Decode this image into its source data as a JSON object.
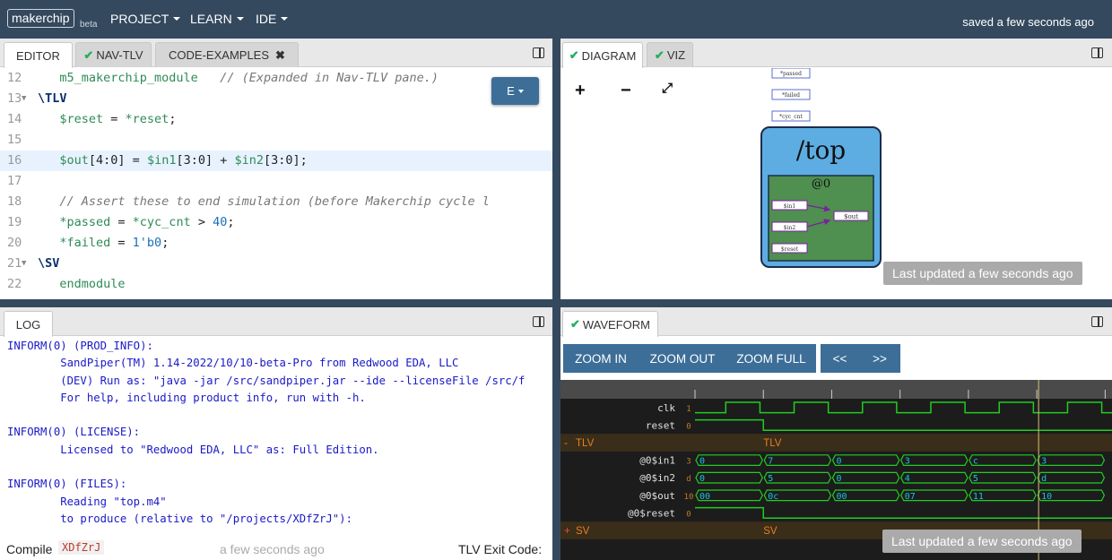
{
  "navbar": {
    "brand": "makerchip",
    "beta": "beta",
    "menus": [
      {
        "label": "PROJECT"
      },
      {
        "label": "LEARN"
      },
      {
        "label": "IDE"
      }
    ],
    "status": "saved a few seconds ago"
  },
  "editor_tabs": [
    {
      "label": "EDITOR",
      "active": true,
      "check": false,
      "close": false
    },
    {
      "label": "NAV-TLV",
      "active": false,
      "check": true,
      "close": false
    },
    {
      "label": "CODE-EXAMPLES",
      "active": false,
      "check": false,
      "close": true
    }
  ],
  "editor": {
    "e_button": "E",
    "lines": [
      {
        "num": "12",
        "fold": false,
        "parts": [
          {
            "t": "   m5_makerchip_module   ",
            "c": "green"
          },
          {
            "t": "// (Expanded in Nav-TLV pane.)",
            "c": "comment"
          }
        ]
      },
      {
        "num": "13",
        "fold": true,
        "parts": [
          {
            "t": "\\TLV",
            "c": "kw"
          }
        ]
      },
      {
        "num": "14",
        "fold": false,
        "parts": [
          {
            "t": "   $reset",
            "c": "green"
          },
          {
            "t": " = ",
            "c": "plain"
          },
          {
            "t": "*reset",
            "c": "green"
          },
          {
            "t": ";",
            "c": "plain"
          }
        ]
      },
      {
        "num": "15",
        "fold": false,
        "parts": []
      },
      {
        "num": "16",
        "fold": false,
        "highlight": true,
        "parts": [
          {
            "t": "   $out",
            "c": "green"
          },
          {
            "t": "[4:0]",
            "c": "plain"
          },
          {
            "t": " = ",
            "c": "plain"
          },
          {
            "t": "$in1",
            "c": "green"
          },
          {
            "t": "[3:0]",
            "c": "plain"
          },
          {
            "t": " + ",
            "c": "plain"
          },
          {
            "t": "$in2",
            "c": "green"
          },
          {
            "t": "[3:0]",
            "c": "plain"
          },
          {
            "t": ";",
            "c": "plain"
          }
        ]
      },
      {
        "num": "17",
        "fold": false,
        "parts": []
      },
      {
        "num": "18",
        "fold": false,
        "parts": [
          {
            "t": "   // Assert these to end simulation (before Makerchip cycle l",
            "c": "comment"
          }
        ]
      },
      {
        "num": "19",
        "fold": false,
        "parts": [
          {
            "t": "   *passed",
            "c": "green"
          },
          {
            "t": " = ",
            "c": "plain"
          },
          {
            "t": "*cyc_cnt",
            "c": "green"
          },
          {
            "t": " > ",
            "c": "plain"
          },
          {
            "t": "40",
            "c": "num"
          },
          {
            "t": ";",
            "c": "plain"
          }
        ]
      },
      {
        "num": "20",
        "fold": false,
        "parts": [
          {
            "t": "   *failed",
            "c": "green"
          },
          {
            "t": " = ",
            "c": "plain"
          },
          {
            "t": "1'b0",
            "c": "num"
          },
          {
            "t": ";",
            "c": "plain"
          }
        ]
      },
      {
        "num": "21",
        "fold": true,
        "parts": [
          {
            "t": "\\SV",
            "c": "kw"
          }
        ]
      },
      {
        "num": "22",
        "fold": false,
        "parts": [
          {
            "t": "   endmodule",
            "c": "green"
          }
        ]
      }
    ]
  },
  "diagram_tabs": [
    {
      "label": "DIAGRAM",
      "active": true
    },
    {
      "label": "VIZ",
      "active": false
    }
  ],
  "diagram": {
    "sigs": [
      "*passed",
      "*failed",
      "*cyc_cnt"
    ],
    "top_label": "/top",
    "stage_label": "@0",
    "inputs": [
      "$in1",
      "$in2",
      "$reset"
    ],
    "output": "$out",
    "status": "Last updated a few seconds ago"
  },
  "log": {
    "tab": "LOG",
    "lines": [
      "INFORM(0) (PROD_INFO):",
      "        SandPiper(TM) 1.14-2022/10/10-beta-Pro from Redwood EDA, LLC",
      "        (DEV) Run as: \"java -jar /src/sandpiper.jar --ide --licenseFile /src/f",
      "        For help, including product info, run with -h.",
      "",
      "INFORM(0) (LICENSE):",
      "        Licensed to \"Redwood EDA, LLC\" as: Full Edition.",
      "",
      "INFORM(0) (FILES):",
      "        Reading \"top.m4\"",
      "        to produce (relative to \"/projects/XDfZrJ\"):"
    ],
    "compile_label": "Compile",
    "compile_id": "XDfZrJ",
    "compile_time": "a few seconds ago",
    "exit_code_label": "TLV Exit Code:"
  },
  "waveform": {
    "tab": "WAVEFORM",
    "buttons": [
      "ZOOM IN",
      "ZOOM OUT",
      "ZOOM FULL"
    ],
    "nav_buttons": [
      "<<",
      ">>"
    ],
    "tlv_group": "TLV",
    "sv_group": "SV",
    "status": "Last updated a few seconds ago",
    "cycles_visible": 6.1,
    "cursor_at_cycle": 5,
    "signals": [
      {
        "name": "clk",
        "val": "1",
        "type": "clock"
      },
      {
        "name": "reset",
        "val": "0",
        "type": "bit",
        "values": [
          1,
          0,
          0,
          0,
          0,
          0,
          0
        ]
      },
      {
        "name": "@0$in1",
        "val": "3",
        "type": "bus",
        "values": [
          "0",
          "7",
          "0",
          "3",
          "c",
          "3"
        ]
      },
      {
        "name": "@0$in2",
        "val": "d",
        "type": "bus",
        "values": [
          "0",
          "5",
          "0",
          "4",
          "5",
          "d"
        ]
      },
      {
        "name": "@0$out",
        "val": "10",
        "type": "bus",
        "values": [
          "00",
          "0c",
          "00",
          "07",
          "11",
          "10"
        ]
      },
      {
        "name": "@0$reset",
        "val": "0",
        "type": "bit",
        "values": [
          1,
          0,
          0,
          0,
          0,
          0,
          0
        ]
      }
    ]
  },
  "colors": {
    "navbar": "#34495e",
    "accent_blue": "#3c6e98",
    "check_green": "#27ae60",
    "wave_green": "#22cc22",
    "bus_cyan": "#19c3e0",
    "top_blue": "#5dade2",
    "stage_green": "#4f8f4f"
  }
}
